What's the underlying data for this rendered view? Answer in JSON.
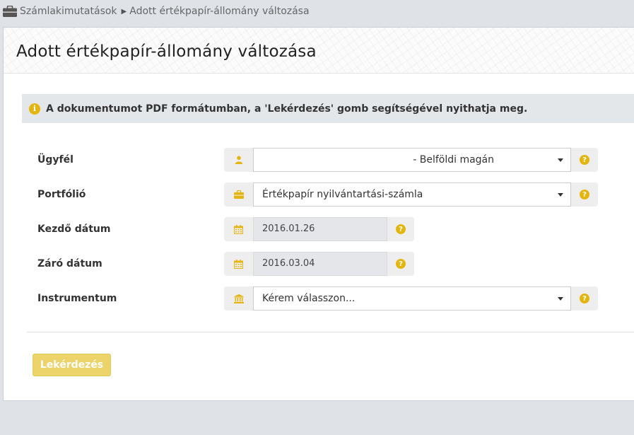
{
  "breadcrumb": {
    "icon": "briefcase-icon",
    "parent": "Számlakimutatások",
    "current": "Adott értékpapír-állomány változása"
  },
  "page": {
    "title": "Adott értékpapír-állomány változása"
  },
  "info": {
    "icon": "info-icon",
    "text": "A dokumentumot PDF formátumban, a 'Lekérdezés' gomb segítségével nyithatja meg."
  },
  "form": {
    "client": {
      "label": "Ügyfél",
      "value": "- Belföldi magán",
      "icon": "user-icon"
    },
    "portfolio": {
      "label": "Portfólió",
      "value": "Értékpapír nyilvántartási-számla",
      "icon": "briefcase-icon"
    },
    "start_date": {
      "label": "Kezdő dátum",
      "value": "2016.01.26",
      "icon": "calendar-icon"
    },
    "end_date": {
      "label": "Záró dátum",
      "value": "2016.03.04",
      "icon": "calendar-icon"
    },
    "instrument": {
      "label": "Instrumentum",
      "value": "Kérem válasszon...",
      "icon": "bank-icon"
    },
    "help_icon_text": "?"
  },
  "actions": {
    "submit_label": "Lekérdezés"
  },
  "colors": {
    "accent": "#e5b50f",
    "button": "#ecd36a",
    "background": "#dfe3e8"
  }
}
